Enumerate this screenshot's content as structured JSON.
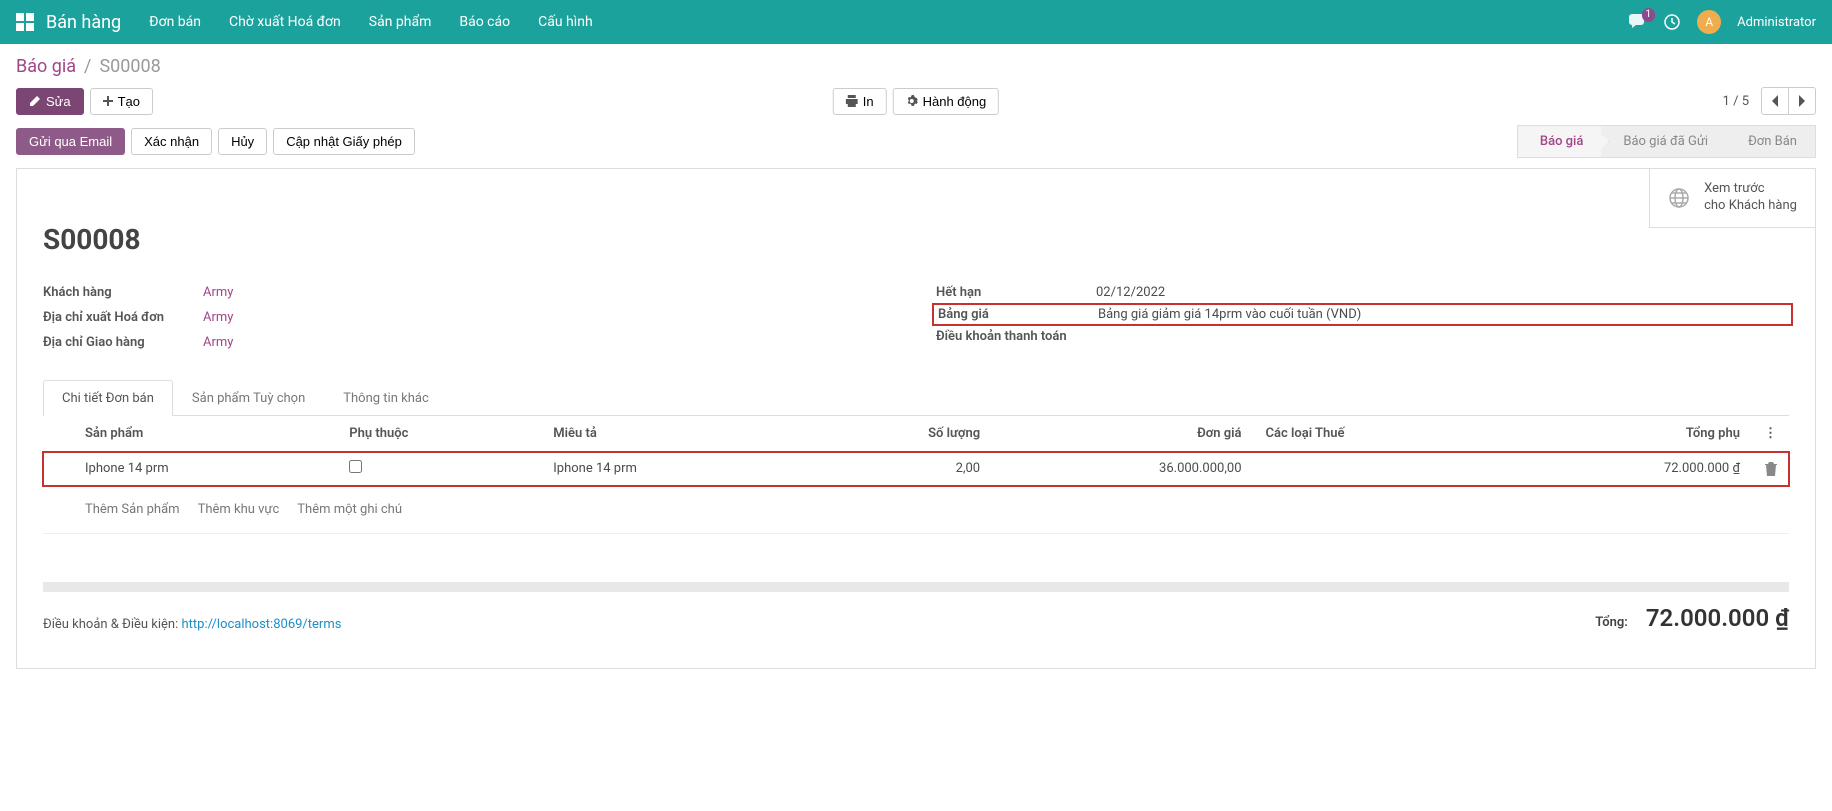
{
  "topbar": {
    "app_title": "Bán hàng",
    "nav": [
      "Đơn bán",
      "Chờ xuất Hoá đơn",
      "Sản phẩm",
      "Báo cáo",
      "Cấu hình"
    ],
    "chat_badge": "1",
    "avatar_letter": "A",
    "username": "Administrator"
  },
  "breadcrumb": {
    "link": "Báo giá",
    "current": "S00008"
  },
  "toolbar": {
    "edit": "Sửa",
    "create": "Tạo",
    "print": "In",
    "action": "Hành động",
    "pager_current": "1",
    "pager_total": "5"
  },
  "action_buttons": {
    "send_email": "Gửi qua Email",
    "confirm": "Xác nhận",
    "cancel": "Hủy",
    "update_license": "Cập nhật Giấy phép"
  },
  "status_steps": [
    "Báo giá",
    "Báo giá đã Gửi",
    "Đơn Bán"
  ],
  "preview": {
    "line1": "Xem trước",
    "line2": "cho Khách hàng"
  },
  "order": {
    "title": "S00008",
    "fields_left": [
      {
        "label": "Khách hàng",
        "value": "Army",
        "is_link": true
      },
      {
        "label": "Địa chỉ xuất Hoá đơn",
        "value": "Army",
        "is_link": true
      },
      {
        "label": "Địa chỉ Giao hàng",
        "value": "Army",
        "is_link": true
      }
    ],
    "fields_right": [
      {
        "label": "Hết hạn",
        "value": "02/12/2022",
        "highlight": false
      },
      {
        "label": "Bảng giá",
        "value": "Bảng giá giảm giá 14prm vào cuối tuần (VND)",
        "highlight": true
      },
      {
        "label": "Điều khoản thanh toán",
        "value": "",
        "highlight": false
      }
    ]
  },
  "tabs": [
    "Chi tiết Đơn bán",
    "Sản phẩm Tuỳ chọn",
    "Thông tin khác"
  ],
  "table": {
    "headers": {
      "product": "Sản phẩm",
      "depends": "Phụ thuộc",
      "description": "Miêu tả",
      "qty": "Số lượng",
      "unit_price": "Đơn giá",
      "taxes": "Các loại Thuế",
      "subtotal": "Tổng phụ"
    },
    "rows": [
      {
        "product": "Iphone 14 prm",
        "depends_checked": false,
        "description": "Iphone 14 prm",
        "qty": "2,00",
        "unit_price": "36.000.000,00",
        "taxes": "",
        "subtotal": "72.000.000 ₫"
      }
    ],
    "add_links": [
      "Thêm Sản phẩm",
      "Thêm khu vực",
      "Thêm một ghi chú"
    ]
  },
  "footer": {
    "terms_prefix": "Điều khoản & Điều kiện: ",
    "terms_url": "http://localhost:8069/terms",
    "total_label": "Tổng:",
    "total_value": "72.000.000 ₫"
  }
}
